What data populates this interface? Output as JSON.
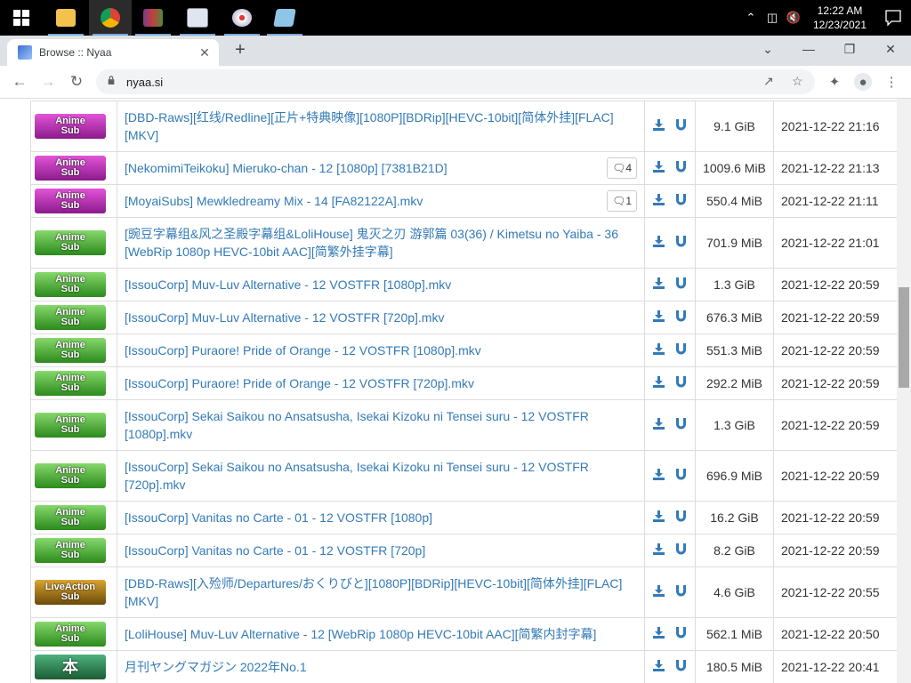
{
  "taskbar": {
    "clock_time": "12:22 AM",
    "clock_date": "12/23/2021",
    "apps": [
      "windows-start-icon",
      "file-explorer-icon",
      "chrome-icon",
      "winrar-icon",
      "app-icon",
      "paint-icon",
      "notepad-icon"
    ]
  },
  "browser": {
    "tab_title": "Browse :: Nyaa",
    "url": "nyaa.si"
  },
  "rows": [
    {
      "category": "sub",
      "cat_top": "Anime",
      "cat_bottom": "Sub",
      "name": "[DBD-Raws][红线/Redline][正片+特典映像][1080P][BDRip][HEVC-10bit][简体外挂][FLAC][MKV]",
      "comments": "",
      "size": "9.1 GiB",
      "date": "2021-12-22 21:16",
      "tall": true
    },
    {
      "category": "sub",
      "cat_top": "Anime",
      "cat_bottom": "Sub",
      "name": "[NekomimiTeikoku] Mieruko-chan - 12 [1080p] [7381B21D]",
      "comments": "4",
      "size": "1009.6 MiB",
      "date": "2021-12-22 21:13",
      "tall": false
    },
    {
      "category": "sub",
      "cat_top": "Anime",
      "cat_bottom": "Sub",
      "name": "[MoyaiSubs] Mewkledreamy Mix - 14 [FA82122A].mkv",
      "comments": "1",
      "size": "550.4 MiB",
      "date": "2021-12-22 21:11",
      "tall": false
    },
    {
      "category": "raw",
      "cat_top": "Anime",
      "cat_bottom": "Sub",
      "name": "[豌豆字幕组&风之圣殿字幕组&LoliHouse] 鬼灭之刃 游郭篇 03(36) / Kimetsu no Yaiba - 36 [WebRip 1080p HEVC-10bit AAC][简繁外挂字幕]",
      "comments": "",
      "size": "701.9 MiB",
      "date": "2021-12-22 21:01",
      "tall": true
    },
    {
      "category": "raw",
      "cat_top": "Anime",
      "cat_bottom": "Sub",
      "name": "[IssouCorp] Muv-Luv Alternative - 12 VOSTFR [1080p].mkv",
      "comments": "",
      "size": "1.3 GiB",
      "date": "2021-12-22 20:59",
      "tall": false
    },
    {
      "category": "raw",
      "cat_top": "Anime",
      "cat_bottom": "Sub",
      "name": "[IssouCorp] Muv-Luv Alternative - 12 VOSTFR [720p].mkv",
      "comments": "",
      "size": "676.3 MiB",
      "date": "2021-12-22 20:59",
      "tall": false
    },
    {
      "category": "raw",
      "cat_top": "Anime",
      "cat_bottom": "Sub",
      "name": "[IssouCorp] Puraore! Pride of Orange - 12 VOSTFR [1080p].mkv",
      "comments": "",
      "size": "551.3 MiB",
      "date": "2021-12-22 20:59",
      "tall": false
    },
    {
      "category": "raw",
      "cat_top": "Anime",
      "cat_bottom": "Sub",
      "name": "[IssouCorp] Puraore! Pride of Orange - 12 VOSTFR [720p].mkv",
      "comments": "",
      "size": "292.2 MiB",
      "date": "2021-12-22 20:59",
      "tall": false
    },
    {
      "category": "raw",
      "cat_top": "Anime",
      "cat_bottom": "Sub",
      "name": "[IssouCorp] Sekai Saikou no Ansatsusha, Isekai Kizoku ni Tensei suru - 12 VOSTFR [1080p].mkv",
      "comments": "",
      "size": "1.3 GiB",
      "date": "2021-12-22 20:59",
      "tall": true
    },
    {
      "category": "raw",
      "cat_top": "Anime",
      "cat_bottom": "Sub",
      "name": "[IssouCorp] Sekai Saikou no Ansatsusha, Isekai Kizoku ni Tensei suru - 12 VOSTFR [720p].mkv",
      "comments": "",
      "size": "696.9 MiB",
      "date": "2021-12-22 20:59",
      "tall": true
    },
    {
      "category": "raw",
      "cat_top": "Anime",
      "cat_bottom": "Sub",
      "name": "[IssouCorp] Vanitas no Carte - 01 - 12 VOSTFR [1080p]",
      "comments": "",
      "size": "16.2 GiB",
      "date": "2021-12-22 20:59",
      "tall": false
    },
    {
      "category": "raw",
      "cat_top": "Anime",
      "cat_bottom": "Sub",
      "name": "[IssouCorp] Vanitas no Carte - 01 - 12 VOSTFR [720p]",
      "comments": "",
      "size": "8.2 GiB",
      "date": "2021-12-22 20:59",
      "tall": false
    },
    {
      "category": "live",
      "cat_top": "LiveAction",
      "cat_bottom": "Sub",
      "name": "[DBD-Raws][入殓师/Departures/おくりびと][1080P][BDRip][HEVC-10bit][简体外挂][FLAC][MKV]",
      "comments": "",
      "size": "4.6 GiB",
      "date": "2021-12-22 20:55",
      "tall": true
    },
    {
      "category": "raw",
      "cat_top": "Anime",
      "cat_bottom": "Sub",
      "name": "[LoliHouse] Muv-Luv Alternative - 12 [WebRip 1080p HEVC-10bit AAC][简繁内封字幕]",
      "comments": "",
      "size": "562.1 MiB",
      "date": "2021-12-22 20:50",
      "tall": false
    },
    {
      "category": "book",
      "cat_top": "本",
      "cat_bottom": "",
      "name": "月刊ヤングマガジン 2022年No.1",
      "comments": "",
      "size": "180.5 MiB",
      "date": "2021-12-22 20:41",
      "tall": false
    }
  ]
}
